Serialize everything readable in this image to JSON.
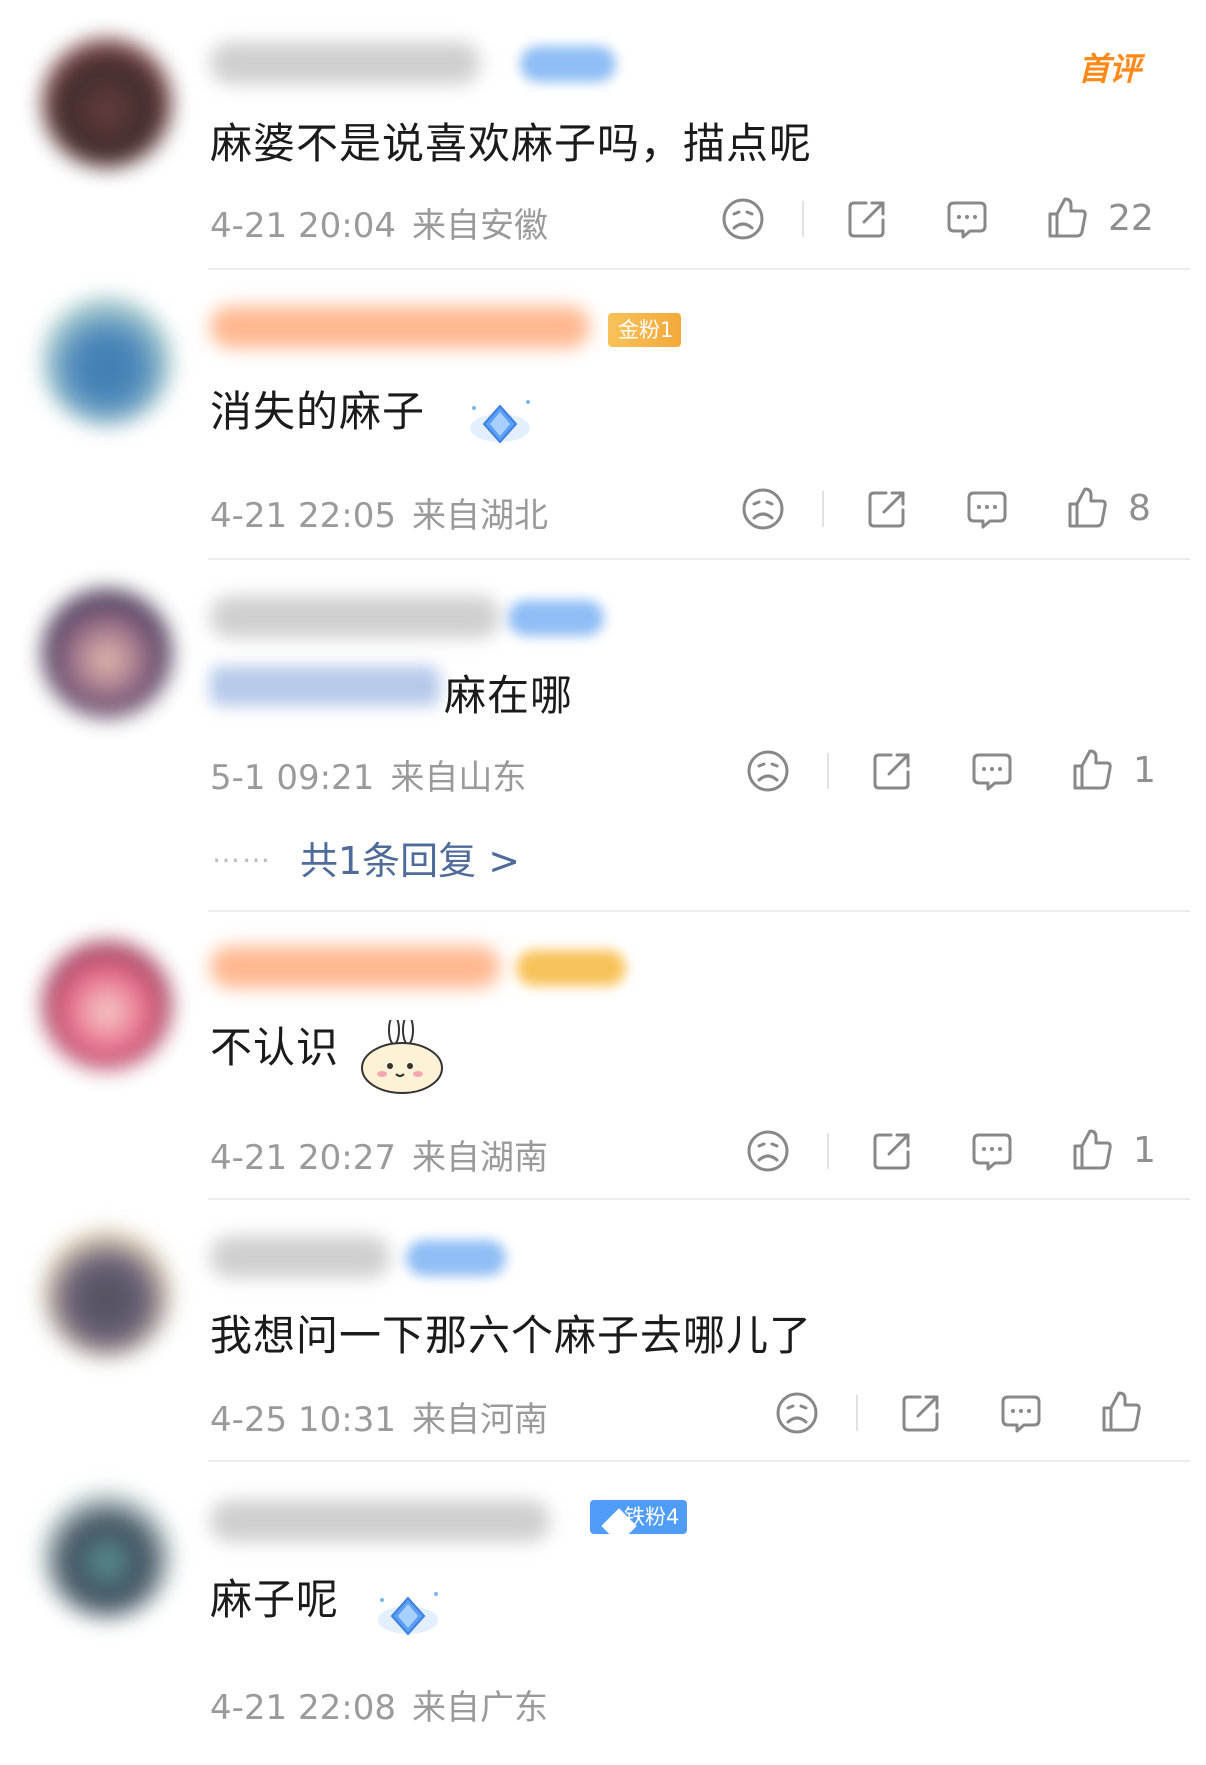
{
  "comments": [
    {
      "first_badge": "首评",
      "text": "麻婆不是说喜欢麻子吗，描点呢",
      "date": "4-21 20:04",
      "location": "来自安徽",
      "likes": "22"
    },
    {
      "badge": "金粉1",
      "text": "消失的麻子",
      "date": "4-21 22:05",
      "location": "来自湖北",
      "likes": "8"
    },
    {
      "text": "麻在哪",
      "date": "5-1 09:21",
      "location": "来自山东",
      "likes": "1",
      "dots": "……",
      "replies": "共1条回复 >"
    },
    {
      "text": "不认识",
      "date": "4-21 20:27",
      "location": "来自湖南",
      "likes": "1"
    },
    {
      "text": "我想问一下那六个麻子去哪儿了",
      "date": "4-25 10:31",
      "location": "来自河南",
      "likes": ""
    },
    {
      "badge": "铁粉4",
      "text": "麻子呢",
      "date": "4-21 22:08",
      "location": "来自广东"
    }
  ],
  "icons": [
    "dislike-icon",
    "share-icon",
    "comment-icon",
    "like-icon",
    "diamond-sticker",
    "bunny-sticker"
  ],
  "colors": {
    "gold_badge": "#f7b733",
    "iron_badge": "#4f9df8",
    "first_badge": "#ff8a1a",
    "reply_link": "#4f6b99"
  }
}
